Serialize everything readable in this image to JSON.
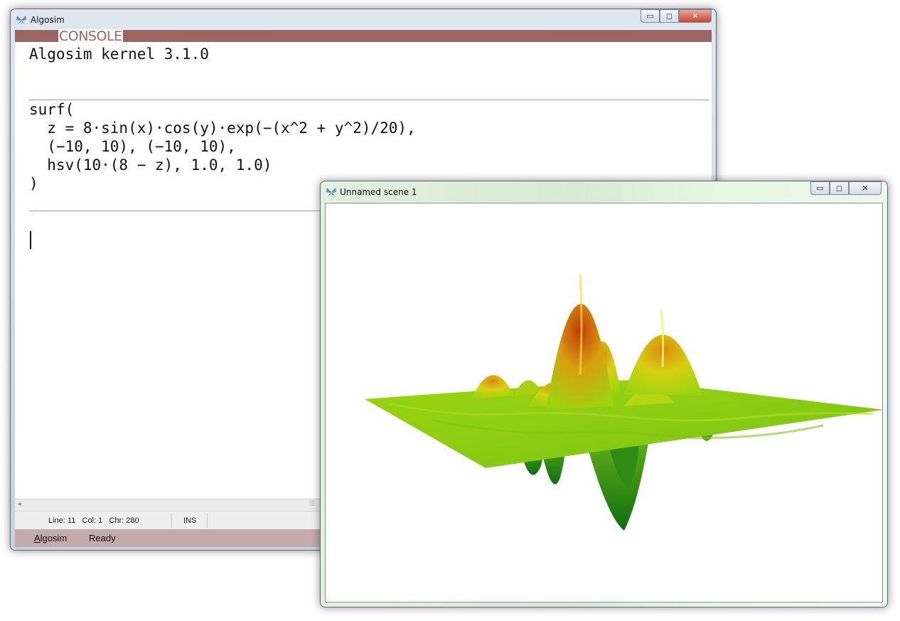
{
  "main_window": {
    "title": "Algosim",
    "controls": {
      "minimize": "▭",
      "maximize": "◻",
      "close": "✕"
    },
    "console": {
      "tab_label": "CONSOLE",
      "banner": "Algosim kernel 3.1.0",
      "command_lines": [
        "surf(",
        "  z = 8·sin(x)·cos(y)·exp(−(x^2 + y^2)/20),",
        "  (−10, 10), (−10, 10),",
        "  hsv(10·(8 − z), 1.0, 1.0)",
        ")"
      ]
    },
    "scrollbar": {
      "left_arrow": "◂",
      "grip": "⁞⁞⁞"
    },
    "status": {
      "position": "Line: 11   Col: 1   Chr: 280",
      "mode": "INS"
    },
    "bottom": {
      "app_label_first": "A",
      "app_label_rest": "lgosim",
      "state": "Ready"
    }
  },
  "scene_window": {
    "title": "Unnamed scene 1",
    "controls": {
      "minimize": "▭",
      "maximize": "◻",
      "close": "✕"
    }
  },
  "icons": {
    "app": "butterfly-icon"
  },
  "colors": {
    "console_header": "#9a6563",
    "separator": "#b88e98",
    "bottom_bar": "#c4aaaa",
    "surface_low": "#1d7f16",
    "surface_mid": "#9bd40f",
    "surface_high": "#c23a0a"
  }
}
